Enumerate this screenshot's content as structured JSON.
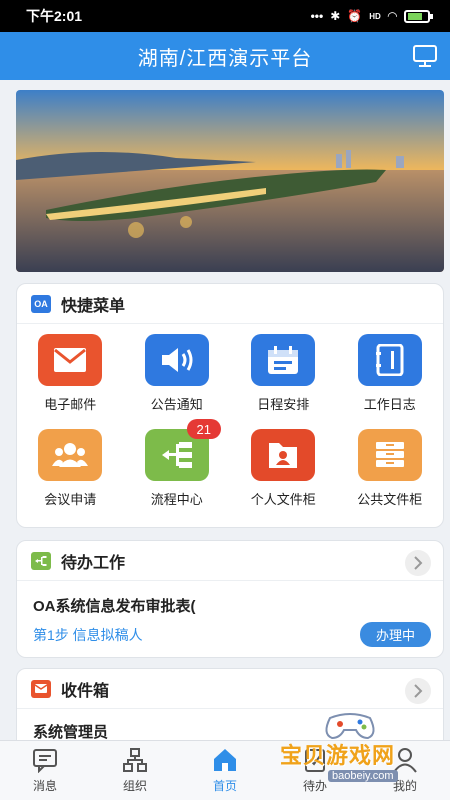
{
  "status_bar": {
    "time": "下午2:01",
    "signal_text": "HD"
  },
  "header": {
    "title": "湖南/江西演示平台",
    "right_icon": "monitor-icon"
  },
  "quick_menu": {
    "title": "快捷菜单",
    "badge_icon_text": "OA",
    "items": [
      {
        "label": "电子邮件",
        "icon": "mail-icon",
        "color": "#e9542e"
      },
      {
        "label": "公告通知",
        "icon": "speaker-icon",
        "color": "#2f79e0"
      },
      {
        "label": "日程安排",
        "icon": "calendar-icon",
        "color": "#2f79e0"
      },
      {
        "label": "工作日志",
        "icon": "notebook-icon",
        "color": "#2f79e0"
      },
      {
        "label": "会议申请",
        "icon": "group-icon",
        "color": "#f1a04a"
      },
      {
        "label": "流程中心",
        "icon": "flow-icon",
        "color": "#7dbb4a",
        "badge": "21"
      },
      {
        "label": "个人文件柜",
        "icon": "folder-user-icon",
        "color": "#e34a2a"
      },
      {
        "label": "公共文件柜",
        "icon": "cabinet-icon",
        "color": "#f1a04a"
      }
    ]
  },
  "todo": {
    "title": "待办工作",
    "item_title": "OA系统信息发布审批表(",
    "item_step": "第1步  信息拟稿人",
    "item_status": "办理中"
  },
  "inbox": {
    "title": "收件箱",
    "item_sender": "系统管理员"
  },
  "tabbar": [
    {
      "label": "消息",
      "icon": "message-icon"
    },
    {
      "label": "组织",
      "icon": "org-icon"
    },
    {
      "label": "首页",
      "icon": "home-icon",
      "active": true
    },
    {
      "label": "待办",
      "icon": "todo-icon"
    },
    {
      "label": "我的",
      "icon": "user-icon"
    }
  ],
  "watermark": {
    "text": "宝贝游戏网",
    "url": "baobeiy.com"
  }
}
